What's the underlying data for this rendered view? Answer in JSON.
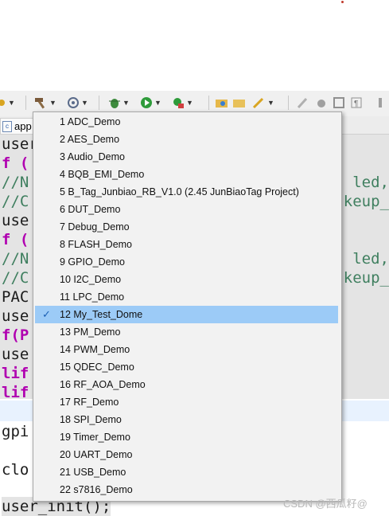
{
  "editor": {
    "tab_label": "app",
    "lines": [
      {
        "text": "user",
        "cls": "bl"
      },
      {
        "text": "f (",
        "cls": "kw"
      },
      {
        "text": "//N",
        "cls": "cm",
        "tail": "led,"
      },
      {
        "text": "//C",
        "cls": "cm",
        "tail": "keup_"
      },
      {
        "text": "use",
        "cls": "bl"
      },
      {
        "text": "f (",
        "cls": "kw"
      },
      {
        "text": "//N",
        "cls": "cm",
        "tail": "led,"
      },
      {
        "text": "//C",
        "cls": "cm",
        "tail": "keup_"
      },
      {
        "text": "PAC",
        "cls": "bl"
      },
      {
        "text": "use",
        "cls": "bl"
      },
      {
        "text": "f(P",
        "cls": "kw"
      },
      {
        "text": "use",
        "cls": "bl"
      },
      {
        "text": "lif",
        "cls": "kw"
      },
      {
        "text": "lif",
        "cls": "kw"
      }
    ],
    "gpio_line": "gpi",
    "clock_line": "clo",
    "last_line": "user_init();"
  },
  "menu": {
    "selected_index": 11,
    "items": [
      "1 ADC_Demo",
      "2 AES_Demo",
      "3 Audio_Demo",
      "4 BQB_EMI_Demo",
      "5 B_Tag_Junbiao_RB_V1.0 (2.45 JunBiaoTag Project)",
      "6 DUT_Demo",
      "7 Debug_Demo",
      "8 FLASH_Demo",
      "9 GPIO_Demo",
      "10 I2C_Demo",
      "11 LPC_Demo",
      "12 My_Test_Dome",
      "13 PM_Demo",
      "14 PWM_Demo",
      "15 QDEC_Demo",
      "16 RF_AOA_Demo",
      "17 RF_Demo",
      "18 SPI_Demo",
      "19 Timer_Demo",
      "20 UART_Demo",
      "21 USB_Demo",
      "22 s7816_Demo"
    ]
  },
  "watermark": "CSDN @西瓜籽@",
  "colors": {
    "menu_selected": "#9ccbf7",
    "keyword": "#b000b0",
    "comment": "#3f7f5f"
  }
}
